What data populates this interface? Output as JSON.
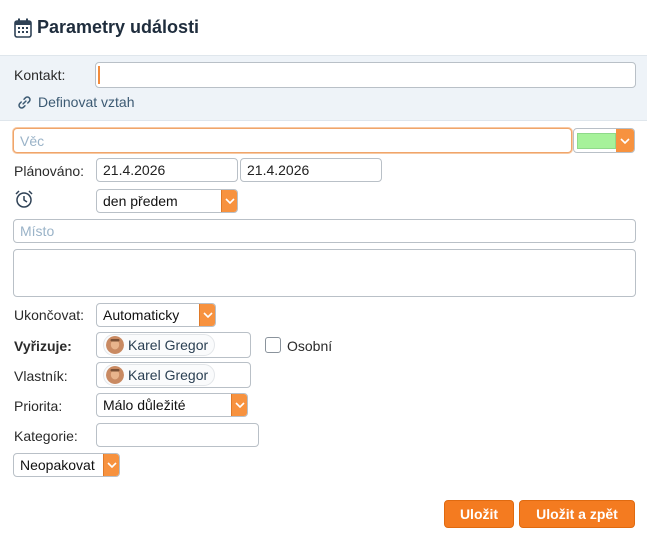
{
  "header": {
    "title": "Parametry události",
    "icon": "calendar-icon"
  },
  "contact": {
    "label": "Kontakt:",
    "value": "",
    "link_label": "Definovat vztah",
    "link_icon": "link-icon"
  },
  "subject": {
    "placeholder": "Věc",
    "value": "",
    "color": "#a6f29a"
  },
  "planned": {
    "label": "Plánováno:",
    "date_from": "21.4.2026",
    "date_to": "21.4.2026"
  },
  "reminder": {
    "icon": "alarm-clock-icon",
    "selected": "den předem"
  },
  "place": {
    "placeholder": "Místo",
    "value": ""
  },
  "notes": {
    "value": ""
  },
  "finish": {
    "label": "Ukončovat:",
    "selected": "Automaticky"
  },
  "assignee": {
    "label": "Vyřizuje:",
    "name": "Karel Gregor"
  },
  "personal": {
    "label": "Osobní",
    "checked": false
  },
  "owner": {
    "label": "Vlastník:",
    "name": "Karel Gregor"
  },
  "priority": {
    "label": "Priorita:",
    "selected": "Málo důležité"
  },
  "category": {
    "label": "Kategorie:",
    "value": ""
  },
  "repeat": {
    "selected": "Neopakovat"
  },
  "buttons": {
    "save": "Uložit",
    "save_back": "Uložit a zpět"
  },
  "colors": {
    "accent": "#f47b20",
    "band": "#eef3f8",
    "title": "#1f2d3d",
    "link": "#3c5a73"
  }
}
